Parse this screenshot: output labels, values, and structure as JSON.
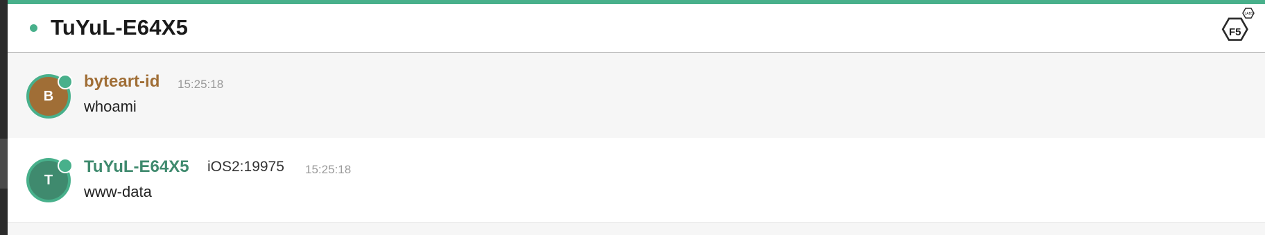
{
  "header": {
    "room_title": "TuYuL-E64X5",
    "status_color": "#48b08b",
    "logo_text": "F5",
    "logo_badge": "LABS"
  },
  "messages": [
    {
      "avatar_letter": "B",
      "avatar_color": "#a06e36",
      "nick": "byteart-id",
      "nick_color": "#a06e36",
      "time": "15:25:18",
      "text": "whoami"
    },
    {
      "avatar_letter": "T",
      "avatar_color": "#3f8a6e",
      "nick": "TuYuL-E64X5",
      "nick_color": "#3f8a6e",
      "client": "iOS2:19975",
      "time": "15:25:18",
      "text": "www-data"
    }
  ],
  "theme": {
    "accent": "#48b08b",
    "online_indicator": "#48b08b"
  }
}
